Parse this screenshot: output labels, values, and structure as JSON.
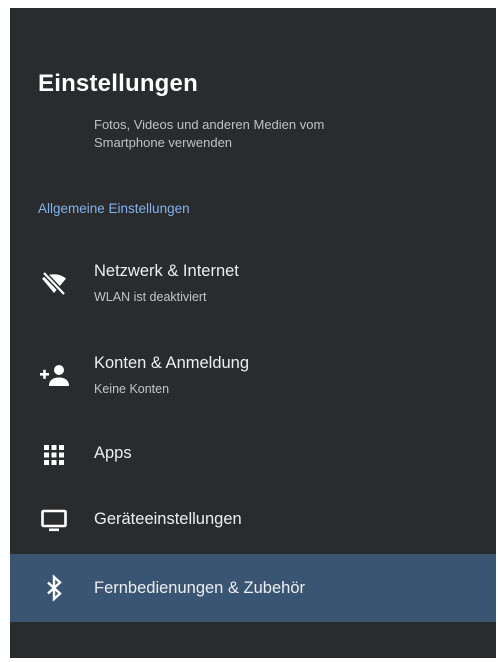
{
  "header": {
    "title": "Einstellungen"
  },
  "partial_item": {
    "line1": "Fotos, Videos und anderen Medien vom",
    "line2": "Smartphone verwenden"
  },
  "section": {
    "label": "Allgemeine Einstellungen"
  },
  "items": [
    {
      "label": "Netzwerk & Internet",
      "sub": "WLAN ist deaktiviert",
      "icon": "wifi-off-icon"
    },
    {
      "label": "Konten & Anmeldung",
      "sub": "Keine Konten",
      "icon": "add-person-icon"
    },
    {
      "label": "Apps",
      "icon": "apps-grid-icon"
    },
    {
      "label": "Geräteeinstellungen",
      "icon": "monitor-icon"
    },
    {
      "label": "Fernbedienungen & Zubehör",
      "icon": "bluetooth-icon",
      "selected": true
    }
  ],
  "colors": {
    "background": "#2a2b2d",
    "accent": "#7fb2ee",
    "selected": "#3a5474",
    "text": "#eceef0"
  }
}
